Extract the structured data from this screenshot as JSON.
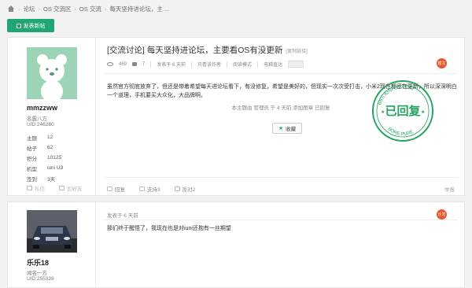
{
  "breadcrumb": {
    "items": [
      "论坛",
      "OS 交流区",
      "OS 交流",
      "每天坚持进论坛，主 ..."
    ]
  },
  "toolbar": {
    "new_post_label": "发表新帖"
  },
  "post1": {
    "user": {
      "name": "mmzzww",
      "group": "名震八方",
      "uid": "UID:246280",
      "stats": [
        {
          "k": "主题",
          "v": "12"
        },
        {
          "k": "帖子",
          "v": "62"
        },
        {
          "k": "积分",
          "v": "10125"
        },
        {
          "k": "机型",
          "v": "iuni U3"
        },
        {
          "k": "签到",
          "v": "3天"
        }
      ],
      "actions": [
        "私信",
        "加好友"
      ]
    },
    "title": "[交流讨论] 每天坚持进论坛，主要看OS有没更新",
    "copy_link": "[复制链接]",
    "views": "469",
    "replies": "7",
    "posted": "发表于 6 天前",
    "author_only": "只看该作者",
    "reading_mode": "阅读模式",
    "order": "电梯直达",
    "floor": "楼主",
    "content": "虽然官方彻底放弃了，但还是带着希望每天进论坛看下，有没修复，希望是美好的，但现实一次次受打击，小米2现在都还在更新，所以深深明白一个道理，手机要买大众化，大品牌啊。",
    "edit_note": "本主题由 管理员 于 4 天前 添加图章 已回复",
    "favorite_label": "收藏",
    "footer_actions": [
      "回复",
      "支持3",
      "反对2"
    ],
    "report": "举报",
    "stamp": {
      "top": "BBS.IUNI OS.COM",
      "main": "已回复",
      "bottom": "BORE PURE"
    }
  },
  "post2": {
    "user": {
      "name": "乐乐18",
      "group": "闻名一方",
      "uid": "UID:255326"
    },
    "posted": "发表于 6 天前",
    "floor": "沙发",
    "content": "那们终于醒悟了，我现在也是对iuni还抱有一丝期望"
  },
  "colors": {
    "accent": "#1fa672",
    "floor_badge": "#e8562a",
    "stamp": "#23a35f"
  }
}
